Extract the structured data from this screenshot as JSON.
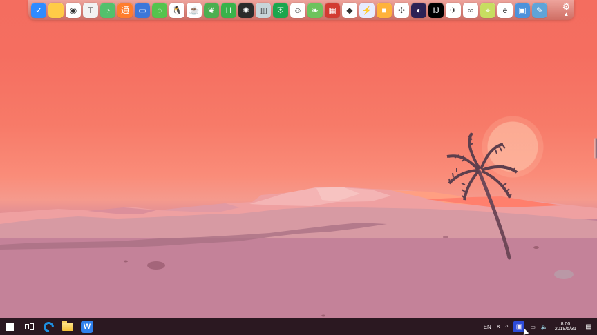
{
  "dock": {
    "icons": [
      {
        "name": "shield-security-icon",
        "bg": "#2f8bff",
        "text": "✓"
      },
      {
        "name": "folder-icon",
        "bg": "#ffcb47",
        "text": ""
      },
      {
        "name": "chrome-icon",
        "bg": "#ffffff",
        "text": "◉"
      },
      {
        "name": "typora-icon",
        "bg": "#f2f2f2",
        "text": "T"
      },
      {
        "name": "eye-care-icon",
        "bg": "#53c06c",
        "text": "◔"
      },
      {
        "name": "orange-app-icon",
        "bg": "#ff7d2d",
        "text": "通"
      },
      {
        "name": "monitor-icon",
        "bg": "#3d77d9",
        "text": "▭"
      },
      {
        "name": "wechat-icon",
        "bg": "#55c34d",
        "text": "◌"
      },
      {
        "name": "qq-icon",
        "bg": "#ffffff",
        "text": "🐧"
      },
      {
        "name": "coffee-icon",
        "bg": "#ffffff",
        "text": "☕"
      },
      {
        "name": "leaf-icon",
        "bg": "#4caf50",
        "text": "❦"
      },
      {
        "name": "hbuilder-icon",
        "bg": "#38b24a",
        "text": "H"
      },
      {
        "name": "flower-icon",
        "bg": "#2b2b2b",
        "text": "✺"
      },
      {
        "name": "image-viewer-icon",
        "bg": "#c8d5d9",
        "text": "▥"
      },
      {
        "name": "green-shield-icon",
        "bg": "#1ba64d",
        "text": "⛨"
      },
      {
        "name": "face-app-icon",
        "bg": "#ffffff",
        "text": "☺"
      },
      {
        "name": "green-leaf-icon",
        "bg": "#6dc25d",
        "text": "❧"
      },
      {
        "name": "red-chart-icon",
        "bg": "#d23b31",
        "text": "▦"
      },
      {
        "name": "diamond-app-icon",
        "bg": "#ffffff",
        "text": "◆"
      },
      {
        "name": "blue-lightning-icon",
        "bg": "#e7ecff",
        "text": "⚡"
      },
      {
        "name": "color-palette-icon",
        "bg": "#ffb23a",
        "text": "■"
      },
      {
        "name": "spread-icon",
        "bg": "#ffffff",
        "text": "✣"
      },
      {
        "name": "eclipse-icon",
        "bg": "#2c2255",
        "text": "◐"
      },
      {
        "name": "intellij-icon",
        "bg": "#000000",
        "text": "IJ"
      },
      {
        "name": "paper-plane-icon",
        "bg": "#ffffff",
        "text": "✈"
      },
      {
        "name": "cloud-app-icon",
        "bg": "#ffffff",
        "text": "∞"
      },
      {
        "name": "map-icon",
        "bg": "#c7dd61",
        "text": "⌖"
      },
      {
        "name": "ie-icon",
        "bg": "#ffffff",
        "text": "e"
      },
      {
        "name": "desktop-icon",
        "bg": "#4d92db",
        "text": "▣"
      },
      {
        "name": "notepad-icon",
        "bg": "#5fa4d8",
        "text": "✎"
      }
    ],
    "gear_icon": "⚙",
    "up_icon": "▲"
  },
  "taskbar": {
    "start_icon": "windows-icon",
    "taskview_icon": "task-view-icon",
    "edge_icon": "edge-icon",
    "folder_icon": "file-explorer-icon",
    "wps_icon": "wps-icon",
    "tray": {
      "lang": "EN",
      "person_icon": "person-icon",
      "chevron_icon": "chevron-up-icon",
      "chip_icon": "blue-chip-icon",
      "monitor_icon": "network-icon",
      "volume_icon": "volume-icon",
      "time": "8:00",
      "date": "2019/5/31",
      "notify_icon": "notification-icon"
    }
  },
  "colors": {
    "sky_top": "#f46d5f",
    "sky_mid": "#f77a68",
    "desert": "#c18195",
    "taskbar": "#2b1821",
    "blue_chip": "#2d4bd8"
  }
}
